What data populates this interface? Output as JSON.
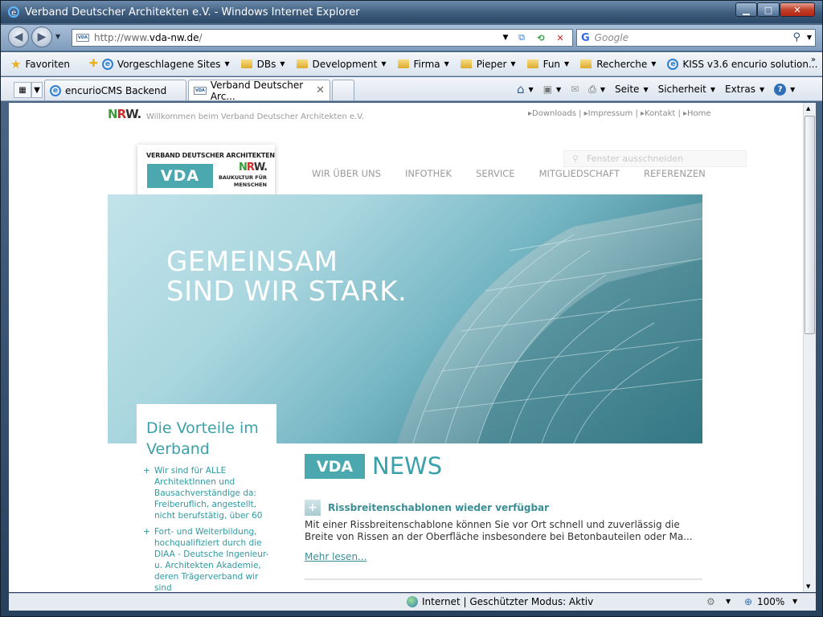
{
  "window": {
    "title": "Verband Deutscher Architekten e.V. - Windows Internet Explorer"
  },
  "address": {
    "url_prefix": "http://www.",
    "url_domain": "vda-nw.de",
    "url_suffix": "/",
    "site_badge": "VDA"
  },
  "search": {
    "provider": "Google",
    "placeholder": "Google"
  },
  "favorites": {
    "label": "Favoriten",
    "items": [
      "Vorgeschlagene Sites",
      "DBs",
      "Development",
      "Firma",
      "Pieper",
      "Fun",
      "Recherche",
      "KISS v3.6 encurio solution..."
    ]
  },
  "tabs": [
    {
      "label": "encurioCMS Backend"
    },
    {
      "label": "Verband Deutscher Arc..."
    }
  ],
  "commands": {
    "page": "Seite",
    "safety": "Sicherheit",
    "tools": "Extras"
  },
  "status": {
    "zone": "Internet | Geschützter Modus: Aktiv",
    "zoom": "100%"
  },
  "page": {
    "welcome": "Willkommen beim Verband Deutscher Architekten e.V.",
    "toplinks": "▸Downloads | ▸Impressum | ▸Kontakt | ▸Home",
    "logo": {
      "title": "VERBAND DEUTSCHER ARCHITEKTEN",
      "box": "VDA",
      "tagline": "BAUKULTUR FÜR MENSCHEN"
    },
    "search_placeholder": "Fenster ausschneiden",
    "nav": [
      "WIR ÜBER UNS",
      "INFOTHEK",
      "SERVICE",
      "MITGLIEDSCHAFT",
      "REFERENZEN"
    ],
    "hero_line1": "GEMEINSAM",
    "hero_line2": "SIND WIR STARK.",
    "benefits": {
      "title": "Die Vorteile im Verband",
      "items": [
        "Wir sind für ALLE ArchitektInnen und Bausachverständige da: Freiberuflich, angestellt, nicht berufstätig, über 60",
        "Fort- und Weiterbildung, hochqualifiziert durch die DIAA - Deutsche Ingenieur- u. Architekten Akademie, deren Trägerverband wir sind"
      ]
    },
    "news": {
      "badge": "VDA",
      "title": "NEWS",
      "headline": "Rissbreitenschablonen wieder verfügbar",
      "text": "Mit einer Rissbreitenschablone können Sie vor Ort schnell und zuverlässig die Breite von Rissen an der Oberfläche insbesondere bei Betonbauteilen oder Ma...",
      "more": "Mehr lesen..."
    }
  },
  "colors": {
    "accent": "#3ba1a8",
    "nrw_green": "#3b9a3c",
    "nrw_red": "#cf2d2a"
  }
}
